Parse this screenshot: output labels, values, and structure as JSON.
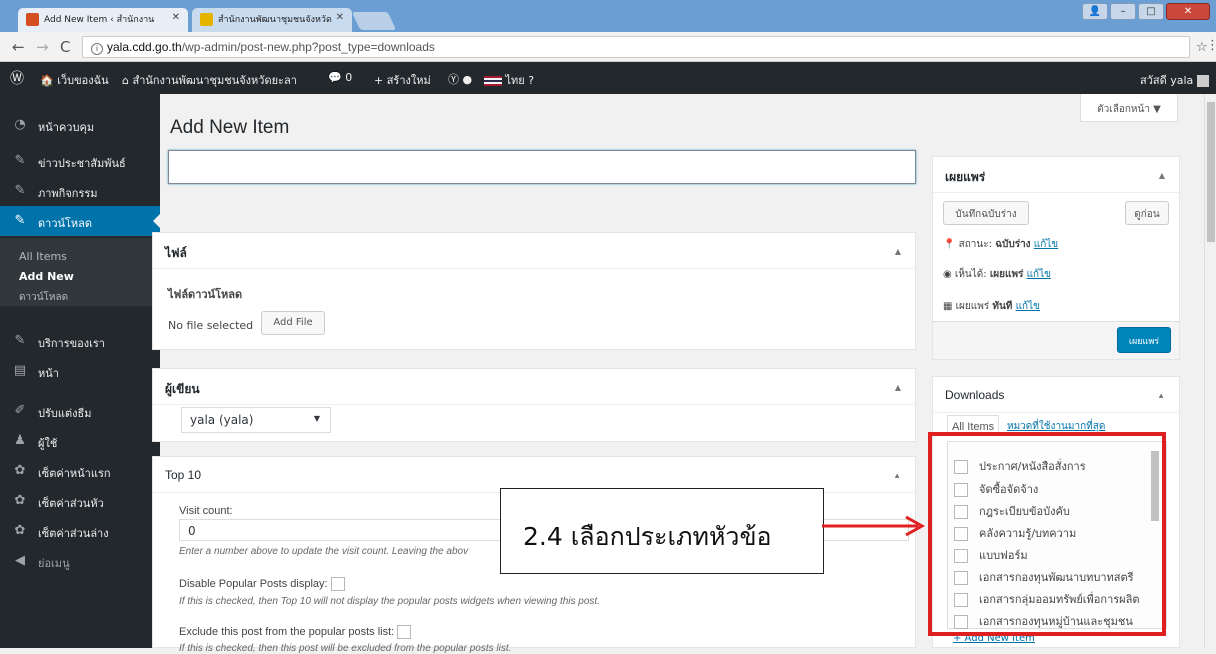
{
  "browser": {
    "tabs": [
      {
        "title": "Add New Item ‹ สำนักงาน"
      },
      {
        "title": "สำนักงานพัฒนาชุมชนจังหวัด"
      }
    ],
    "url_host": "yala.cdd.go.th",
    "url_path": "/wp-admin/post-new.php?post_type=downloads"
  },
  "adminbar": {
    "my_sites": "เว็บของฉัน",
    "site_name": "สำนักงานพัฒนาชุมชนจังหวัดยะลา",
    "comments_count": "0",
    "new_label": "สร้างใหม่",
    "language": "ไทย",
    "greeting": "สวัสดี yala"
  },
  "sidebar": {
    "items": [
      {
        "label": "หน้าควบคุม",
        "icon": "dashboard-icon"
      },
      {
        "label": "ข่าวประชาสัมพันธ์",
        "icon": "pin-icon"
      },
      {
        "label": "ภาพกิจกรรม",
        "icon": "pin-icon"
      },
      {
        "label": "ดาวน์โหลด",
        "icon": "pin-icon"
      },
      {
        "label": "บริการของเรา",
        "icon": "pin-icon"
      },
      {
        "label": "หน้า",
        "icon": "page-icon"
      },
      {
        "label": "ปรับแต่งธีม",
        "icon": "brush-icon"
      },
      {
        "label": "ผู้ใช้",
        "icon": "user-icon"
      },
      {
        "label": "เซ็ตค่าหน้าแรก",
        "icon": "gear-icon"
      },
      {
        "label": "เซ็ตค่าส่วนหัว",
        "icon": "gear-icon"
      },
      {
        "label": "เซ็ตค่าส่วนล่าง",
        "icon": "gear-icon"
      },
      {
        "label": "ย่อเมนู",
        "icon": "collapse-icon"
      }
    ],
    "submenu": [
      "All Items",
      "Add New",
      "ดาวน์โหลด"
    ]
  },
  "screen_options": "ตัวเลือกหน้า ▼",
  "page_title": "Add New Item",
  "file_box": {
    "title": "ไฟล์",
    "label": "ไฟล์ดาวน์โหลด",
    "status": "No file selected",
    "button": "Add File"
  },
  "author_box": {
    "title": "ผู้เขียน",
    "selected": "yala (yala)"
  },
  "top10_box": {
    "title": "Top 10",
    "visit_label": "Visit count:",
    "visit_value": "0",
    "visit_help": "Enter a number above to update the visit count. Leaving the abov",
    "disable_label": "Disable Popular Posts display:",
    "disable_help": "If this is checked, then Top 10 will not display the popular posts widgets when viewing this post.",
    "exclude_label": "Exclude this post from the popular posts list:",
    "exclude_help": "If this is checked, then this post will be excluded from the popular posts list."
  },
  "publish_box": {
    "title": "เผยแพร่",
    "save_draft": "บันทึกฉบับร่าง",
    "preview": "ดูก่อน",
    "status_label": "สถานะ:",
    "status_value": "ฉบับร่าง",
    "visibility_label": "เห็นได้:",
    "visibility_value": "เผยแพร่",
    "schedule_label": "เผยแพร่",
    "schedule_value": "ทันที",
    "edit": "แก้ไข",
    "publish": "เผยแพร่"
  },
  "downloads_box": {
    "title": "Downloads",
    "tab_all": "All Items",
    "tab_popular": "หมวดที่ใช้งานมากที่สุด",
    "categories": [
      "ประกาศ/หนังสือสั่งการ",
      "จัดซื้อจัดจ้าง",
      "กฎระเบียบข้อบังคับ",
      "คลังความรู้/บทความ",
      "แบบฟอร์ม",
      "เอกสารกองทุนพัฒนาบทบาทสตรี",
      "เอกสารกลุ่มออมทรัพย์เพื่อการผลิต",
      "เอกสารกองทุนหมู่บ้านและชุมชน"
    ],
    "add_new": "+ Add New Item"
  },
  "annotation": "2.4 เลือกประเภทหัวข้อ",
  "colors": {
    "highlight": "#e02020",
    "primary": "#0085ba",
    "menu_active": "#0073aa",
    "admin_dark": "#23282d"
  }
}
